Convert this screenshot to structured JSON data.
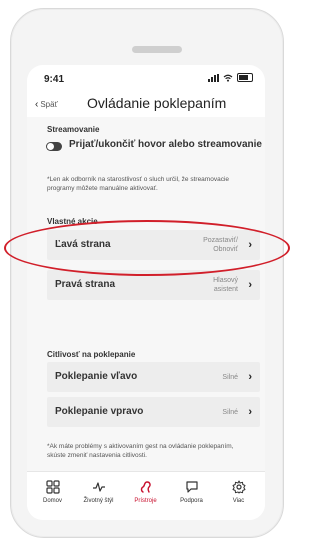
{
  "status": {
    "time": "9:41"
  },
  "nav": {
    "back_label": "Späť",
    "title": "Ovládanie poklepaním"
  },
  "streaming": {
    "section_title": "Streamovanie",
    "toggle_label": "Prijať/ukončiť hovor alebo streamovanie",
    "toggle_on": false,
    "note": "*Len ak odborník na starostlivosť o sluch určil, že streamovacie programy môžete manuálne aktivovať."
  },
  "custom_actions": {
    "section_title": "Vlastné akcie",
    "items": [
      {
        "label": "Ľavá strana",
        "value": "Pozastaviť/ Obnoviť"
      },
      {
        "label": "Pravá strana",
        "value": "Hlasový asistent"
      }
    ]
  },
  "sensitivity": {
    "section_title": "Citlivosť na poklepanie",
    "items": [
      {
        "label": "Poklepanie vľavo",
        "value": "Silné"
      },
      {
        "label": "Poklepanie vpravo",
        "value": "Silné"
      }
    ],
    "note": "*Ak máte problémy s aktivovaním gest na ovládanie poklepaním, skúste zmeniť nastavenia citlivosti."
  },
  "tabbar": {
    "items": [
      {
        "label": "Domov",
        "icon": "grid-icon",
        "active": false
      },
      {
        "label": "Životný štýl",
        "icon": "activity-icon",
        "active": false
      },
      {
        "label": "Prístroje",
        "icon": "hearing-aid-icon",
        "active": true
      },
      {
        "label": "Podpora",
        "icon": "chat-icon",
        "active": false
      },
      {
        "label": "Viac",
        "icon": "gear-icon",
        "active": false
      }
    ]
  },
  "colors": {
    "accent": "#c8102e",
    "annotation": "#d11f2a"
  }
}
